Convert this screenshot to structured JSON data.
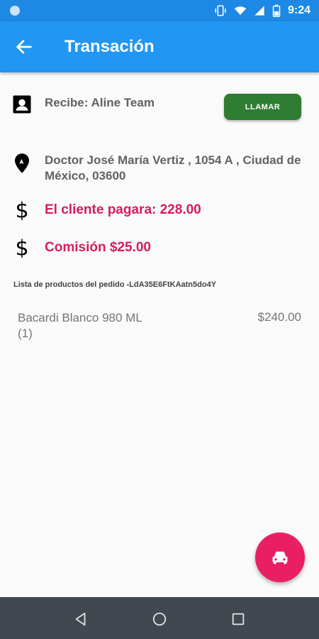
{
  "status_bar": {
    "time": "9:24"
  },
  "app_bar": {
    "title": "Transación"
  },
  "recipient": {
    "label": "Recibe: Aline Team",
    "call_button": "LLAMAR"
  },
  "address": {
    "line1": "Doctor José María Vertiz , 1054 A , Ciudad de",
    "line2": "México, 03600"
  },
  "payment": {
    "client_pays": "El cliente pagara: 228.00",
    "commission": "Comisión $25.00"
  },
  "products": {
    "title": "Lista de productos del pedido -LdA35E6FtKAatn5do4Y",
    "items": [
      {
        "name": "Bacardi Blanco 980 ML",
        "quantity": "(1)",
        "price": "$240.00"
      }
    ]
  },
  "colors": {
    "primary": "#2196f3",
    "status_bar": "#1e88e5",
    "accent": "#e91e63",
    "money_text": "#d81b60",
    "call_button": "#2e7d32"
  }
}
